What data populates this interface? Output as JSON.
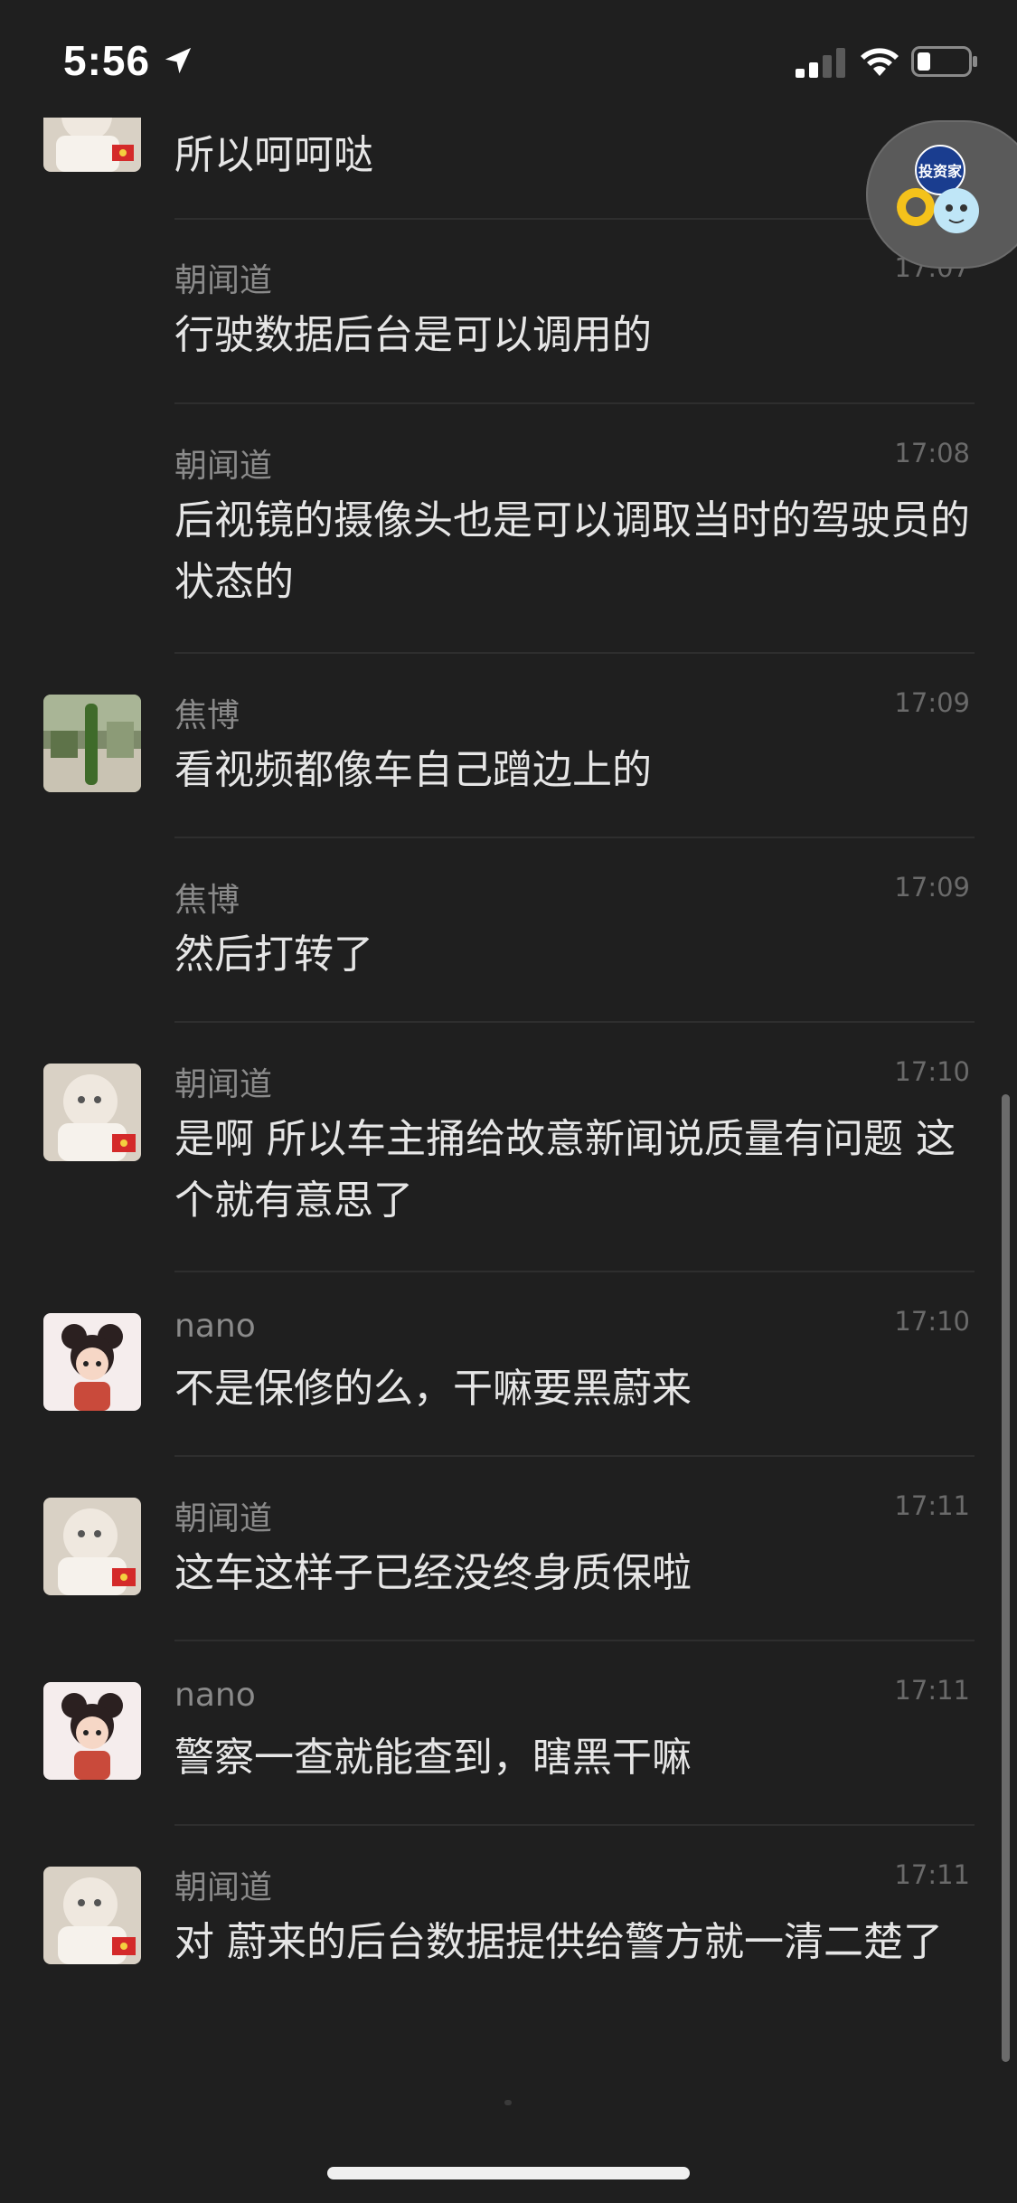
{
  "status_bar": {
    "time": "5:56",
    "icons": [
      "location-arrow-icon",
      "signal-icon",
      "wifi-icon",
      "battery-icon"
    ]
  },
  "messages": [
    {
      "sender": "",
      "time": "",
      "text": "所以呵呵哒",
      "avatar": "avatar-zhaowendao"
    },
    {
      "sender": "朝闻道",
      "time": "17:07",
      "text": "行驶数据后台是可以调用的",
      "avatar": ""
    },
    {
      "sender": "朝闻道",
      "time": "17:08",
      "text": "后视镜的摄像头也是可以调取当时的驾驶员的状态的",
      "avatar": ""
    },
    {
      "sender": "焦博",
      "time": "17:09",
      "text": "看视频都像车自己蹭边上的",
      "avatar": "avatar-jiaobo"
    },
    {
      "sender": "焦博",
      "time": "17:09",
      "text": "然后打转了",
      "avatar": ""
    },
    {
      "sender": "朝闻道",
      "time": "17:10",
      "text": "是啊 所以车主捅给故意新闻说质量有问题 这个就有意思了",
      "avatar": "avatar-zhaowendao"
    },
    {
      "sender": "nano",
      "time": "17:10",
      "text": "不是保修的么，干嘛要黑蔚来",
      "avatar": "avatar-nano"
    },
    {
      "sender": "朝闻道",
      "time": "17:11",
      "text": "这车这样子已经没终身质保啦",
      "avatar": "avatar-zhaowendao"
    },
    {
      "sender": "nano",
      "time": "17:11",
      "text": "警察一查就能查到，瞎黑干嘛",
      "avatar": "avatar-nano"
    },
    {
      "sender": "朝闻道",
      "time": "17:11",
      "text": "对 蔚来的后台数据提供给警方就一清二楚了",
      "avatar": "avatar-zhaowendao"
    }
  ],
  "float_bubble": {
    "logo_text": "投资家"
  },
  "colors": {
    "background": "#1f1f1f",
    "text": "#e6e6e6",
    "sender": "#8a8a8a",
    "time": "#6a6a6a",
    "divider": "#2e2e2e"
  }
}
